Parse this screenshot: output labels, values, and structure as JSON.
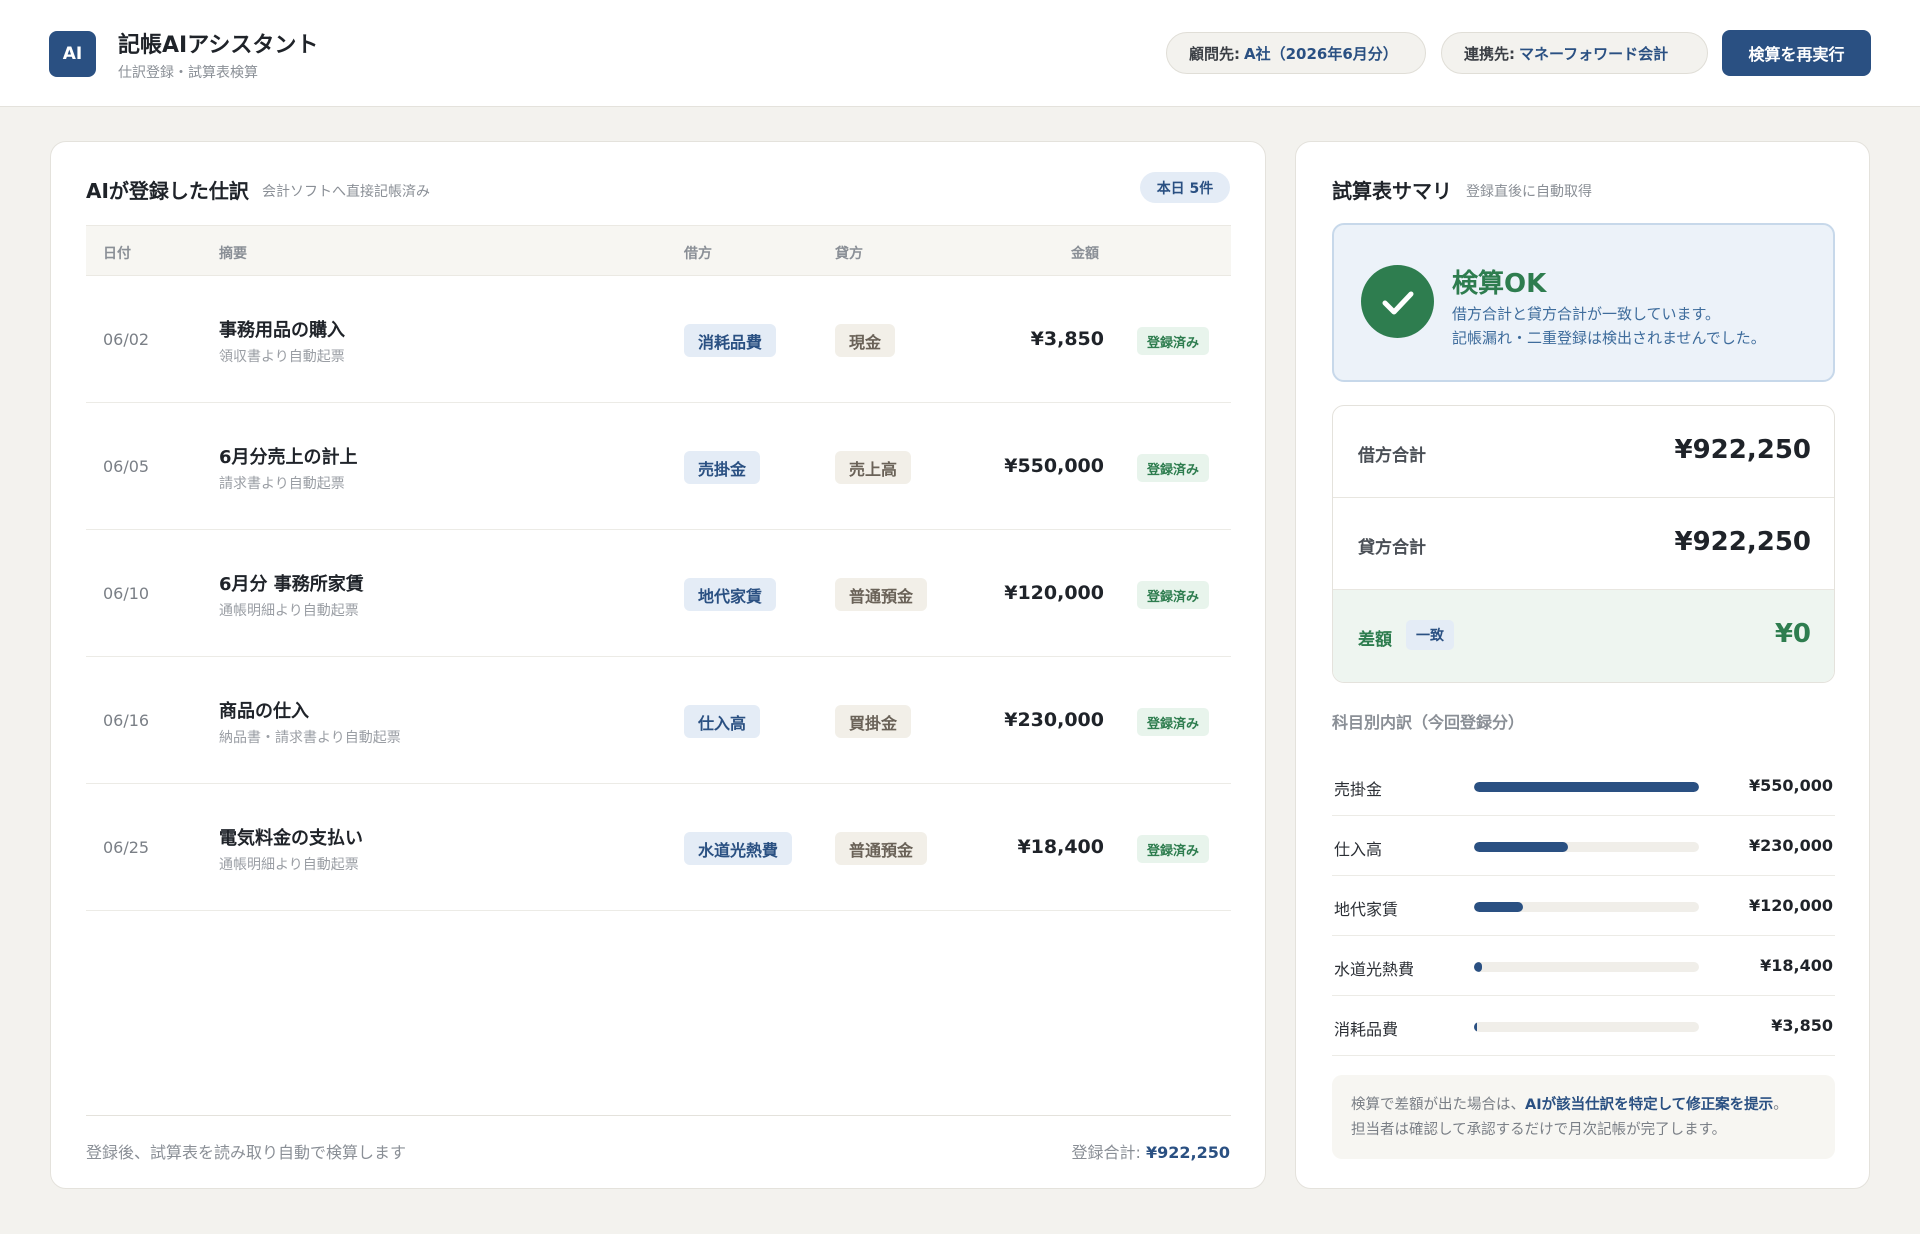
{
  "header": {
    "logo_text": "AI",
    "title": "記帳AIアシスタント",
    "subtitle": "仕訳登録・試算表検算",
    "client_label": "顧問先:",
    "client_value": "A社（2026年6月分）",
    "link_label": "連携先:",
    "link_value": "マネーフォワード会計",
    "rerun_button": "検算を再実行"
  },
  "journal": {
    "title": "AIが登録した仕訳",
    "subtitle": "会計ソフトへ直接記帳済み",
    "today_badge": "本日 5件",
    "columns": {
      "date": "日付",
      "description": "摘要",
      "debit": "借方",
      "credit": "貸方",
      "amount": "金額"
    },
    "rows": [
      {
        "date": "06/02",
        "description": "事務用品の購入",
        "source": "領収書より自動起票",
        "debit": "消耗品費",
        "credit": "現金",
        "amount": "¥3,850",
        "status": "登録済み"
      },
      {
        "date": "06/05",
        "description": "6月分売上の計上",
        "source": "請求書より自動起票",
        "debit": "売掛金",
        "credit": "売上高",
        "amount": "¥550,000",
        "status": "登録済み"
      },
      {
        "date": "06/10",
        "description": "6月分 事務所家賃",
        "source": "通帳明細より自動起票",
        "debit": "地代家賃",
        "credit": "普通預金",
        "amount": "¥120,000",
        "status": "登録済み"
      },
      {
        "date": "06/16",
        "description": "商品の仕入",
        "source": "納品書・請求書より自動起票",
        "debit": "仕入高",
        "credit": "買掛金",
        "amount": "¥230,000",
        "status": "登録済み"
      },
      {
        "date": "06/25",
        "description": "電気料金の支払い",
        "source": "通帳明細より自動起票",
        "debit": "水道光熱費",
        "credit": "普通預金",
        "amount": "¥18,400",
        "status": "登録済み"
      }
    ],
    "footer_note": "登録後、試算表を読み取り自動で検算します",
    "footer_total_label": "登録合計:",
    "footer_total_value": "¥922,250"
  },
  "summary": {
    "title": "試算表サマリ",
    "subtitle": "登録直後に自動取得",
    "ok_title": "検算OK",
    "ok_message_1": "借方合計と貸方合計が一致しています。",
    "ok_message_2": "記帳漏れ・二重登録は検出されませんでした。",
    "debit_total_label": "借方合計",
    "debit_total_value": "¥922,250",
    "credit_total_label": "貸方合計",
    "credit_total_value": "¥922,250",
    "diff_label": "差額",
    "diff_badge": "一致",
    "diff_value": "¥0",
    "breakdown_title": "科目別内訳（今回登録分）",
    "breakdown": [
      {
        "label": "売掛金",
        "value": "¥550,000",
        "amount": 550000
      },
      {
        "label": "仕入高",
        "value": "¥230,000",
        "amount": 230000
      },
      {
        "label": "地代家賃",
        "value": "¥120,000",
        "amount": 120000
      },
      {
        "label": "水道光熱費",
        "value": "¥18,400",
        "amount": 18400
      },
      {
        "label": "消耗品費",
        "value": "¥3,850",
        "amount": 3850
      }
    ],
    "note_part1": "検算で差額が出た場合は、",
    "note_highlight": "AIが該当仕訳を特定して修正案を提示",
    "note_part2": "。",
    "note_line2": "担当者は確認して承認するだけで月次記帳が完了します。"
  },
  "colors": {
    "accent": "#2a5082",
    "success": "#2e7d4f",
    "background": "#f3f2ee"
  }
}
